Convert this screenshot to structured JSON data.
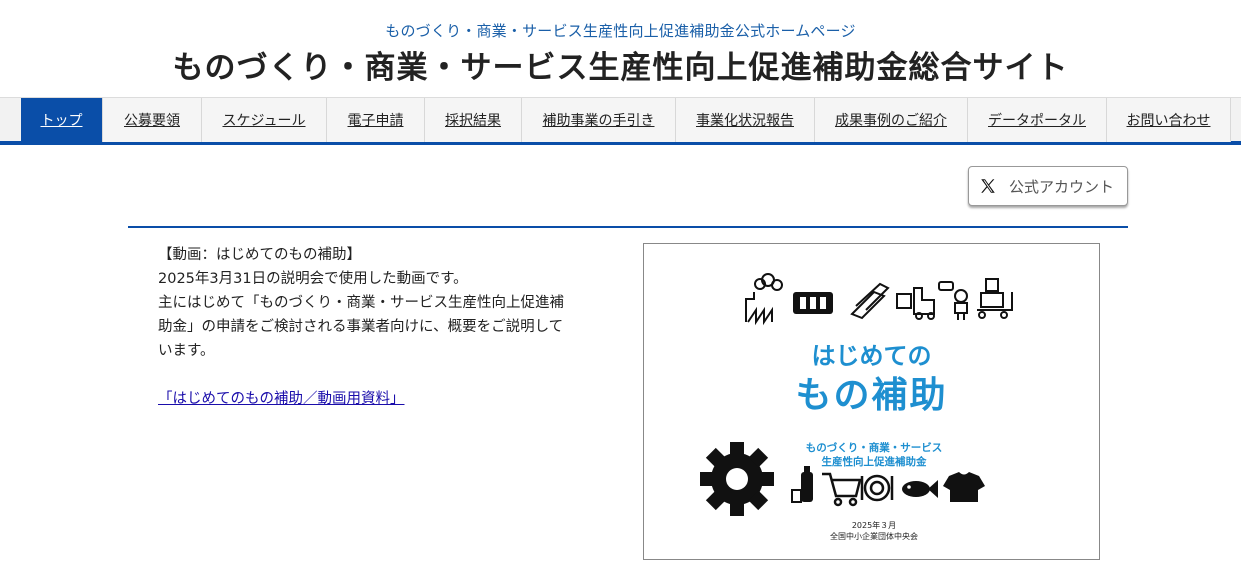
{
  "header": {
    "subtitle": "ものづくり・商業・サービス生産性向上促進補助金公式ホームページ",
    "title": "ものづくり・商業・サービス生産性向上促進補助金総合サイト"
  },
  "nav": {
    "items": [
      {
        "label": "トップ",
        "active": true
      },
      {
        "label": "公募要領"
      },
      {
        "label": "スケジュール"
      },
      {
        "label": "電子申請"
      },
      {
        "label": "採択結果"
      },
      {
        "label": "補助事業の手引き"
      },
      {
        "label": "事業化状況報告"
      },
      {
        "label": "成果事例のご紹介"
      },
      {
        "label": "データポータル"
      },
      {
        "label": "お問い合わせ"
      }
    ]
  },
  "x_button": {
    "label": "公式アカウント",
    "icon": "x-logo-icon"
  },
  "video": {
    "heading": "【動画：はじめてのもの補助】",
    "line1": "2025年3月31日の説明会で使用した動画です。",
    "line2": "主にはじめて「ものづくり・商業・サービス生産性向上促進補",
    "line3": "助金」の申請をご検討される事業者向けに、概要をご説明して",
    "line4": "います。",
    "link": "「はじめてのもの補助／動画用資料」"
  },
  "poster": {
    "title1": "はじめての",
    "title2": "もの補助",
    "sub1": "ものづくり・商業・サービス",
    "sub2": "生産性向上促進補助金",
    "date": "2025年３月",
    "org": "全国中小企業団体中央会",
    "accent": "#1e8fd0"
  },
  "colors": {
    "brand": "#0a4ea8",
    "link": "#1a0dab"
  }
}
